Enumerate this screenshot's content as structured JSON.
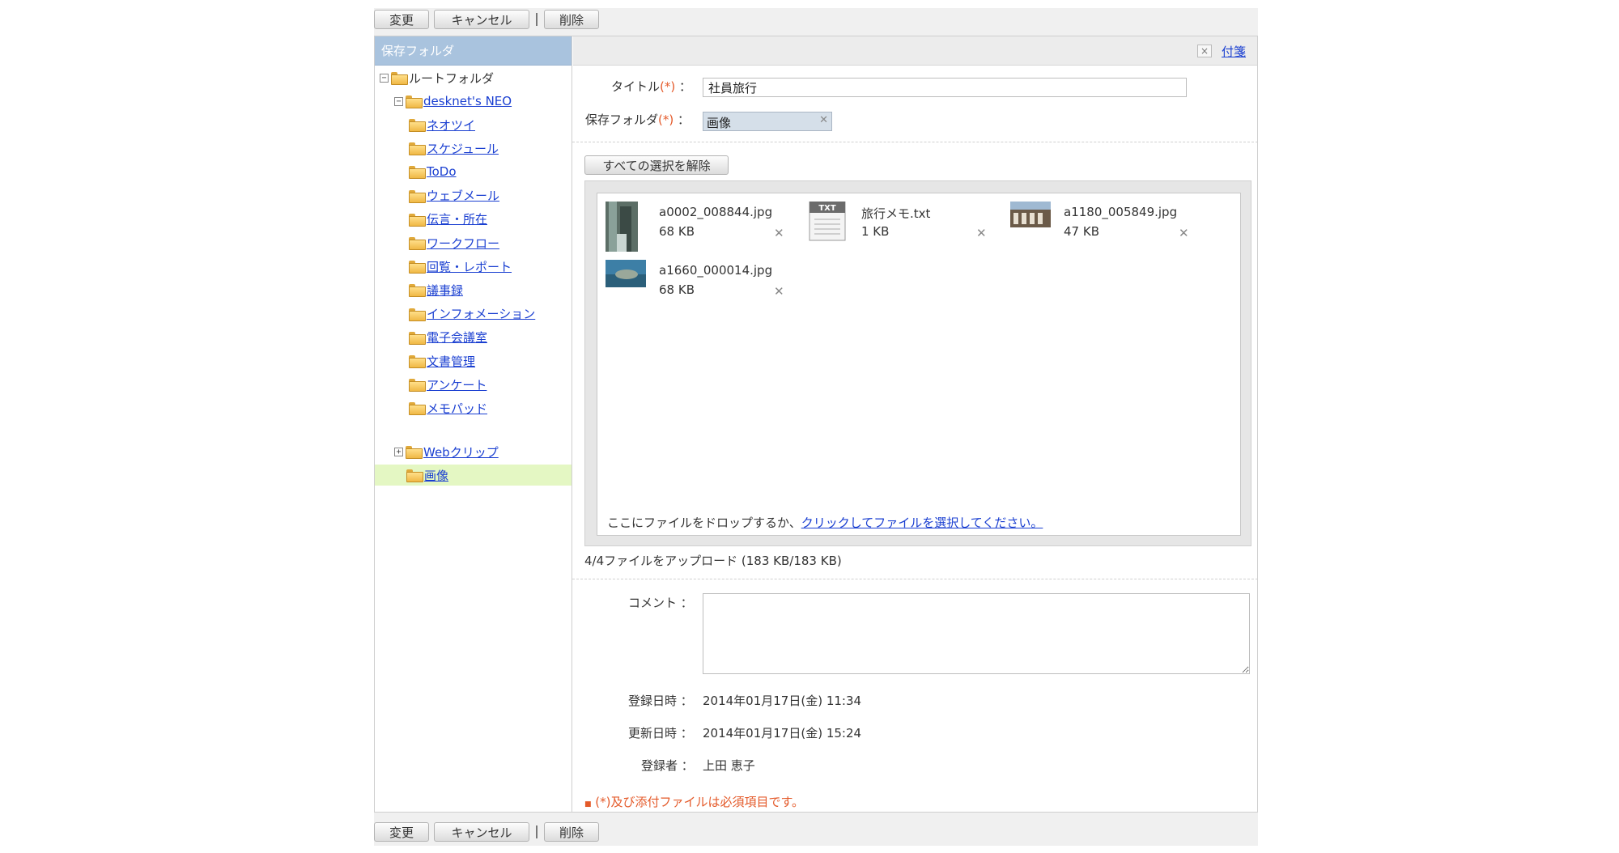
{
  "toolbar": {
    "change_label": "変更",
    "cancel_label": "キャンセル",
    "delete_label": "削除"
  },
  "tree": {
    "header": "保存フォルダ",
    "root": "ルートフォルダ",
    "desknets": "desknet's NEO",
    "items": [
      "ネオツイ",
      "スケジュール",
      "ToDo",
      "ウェブメール",
      "伝言・所在",
      "ワークフロー",
      "回覧・レポート",
      "議事録",
      "インフォメーション",
      "電子会議室",
      "文書管理",
      "アンケート",
      "メモパッド"
    ],
    "webclip": "Webクリップ",
    "selected": "画像"
  },
  "header": {
    "tag_link": "付箋",
    "tag_close": "×"
  },
  "form": {
    "title_label": "タイトル",
    "required_mark": "(*)",
    "colon": "：",
    "title_value": "社員旅行",
    "folder_label": "保存フォルダ",
    "folder_value": "画像",
    "clear_selection": "すべての選択を解除",
    "drop_hint": "ここにファイルをドロップするか、",
    "drop_link": "クリックしてファイルを選択してください。",
    "upload_status": "4/4ファイルをアップロード (183 KB/183 KB)",
    "comment_label": "コメント",
    "created_label": "登録日時",
    "created_value": "2014年01月17日(金) 11:34",
    "updated_label": "更新日時",
    "updated_value": "2014年01月17日(金) 15:24",
    "author_label": "登録者",
    "author_value": "上田 恵子",
    "required_note": "(*)及び添付ファイルは必須項目です。",
    "note_mark": "■"
  },
  "files": [
    {
      "name": "a0002_008844.jpg",
      "size": "68 KB",
      "icon": "photo-thumbnail-icon"
    },
    {
      "name": "旅行メモ.txt",
      "size": "1 KB",
      "icon": "txt-file-icon"
    },
    {
      "name": "a1180_005849.jpg",
      "size": "47 KB",
      "icon": "photo-thumbnail-icon"
    },
    {
      "name": "a1660_000014.jpg",
      "size": "68 KB",
      "icon": "photo-thumbnail-icon"
    }
  ],
  "file_delete": "✕",
  "colors": {
    "header_blue": "#a9c3de",
    "selected_green": "#e4f7c3",
    "link": "#1a3fd1",
    "required": "#e45a2a"
  }
}
